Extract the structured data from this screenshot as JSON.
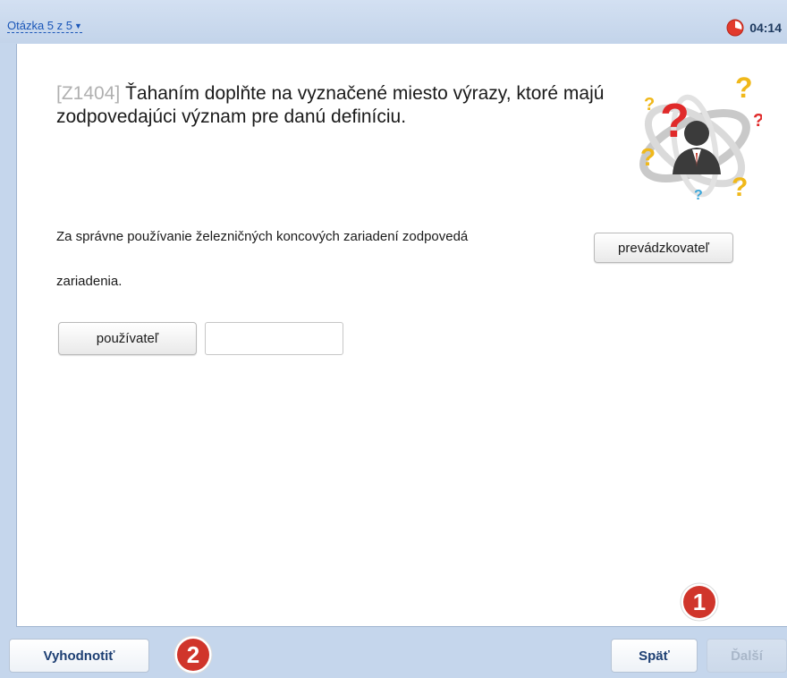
{
  "header": {
    "question_nav": "Otázka 5 z 5",
    "timer": "04:14"
  },
  "question": {
    "code": "[Z1404]",
    "text": "Ťahaním doplňte na vyznačené miesto výrazy, ktoré majú zodpovedajúci význam pre danú definíciu.",
    "image_icon": "person-with-question-marks-icon"
  },
  "task": {
    "sentence_part1": "Za správne používanie železničných koncových zariadení zodpovedá",
    "sentence_part2": "zariadenia.",
    "dropped_answer": "prevádzkovateľ",
    "bank_items": [
      "používateľ"
    ],
    "empty_slot_value": ""
  },
  "footer": {
    "evaluate_label": "Vyhodnotiť",
    "back_label": "Späť",
    "next_label": "Ďalší",
    "badge_1": "1",
    "badge_2": "2"
  },
  "colors": {
    "background": "#c5d6ec",
    "link": "#1a56b8",
    "badge": "#d0352b",
    "button_text": "#1d3f73"
  }
}
